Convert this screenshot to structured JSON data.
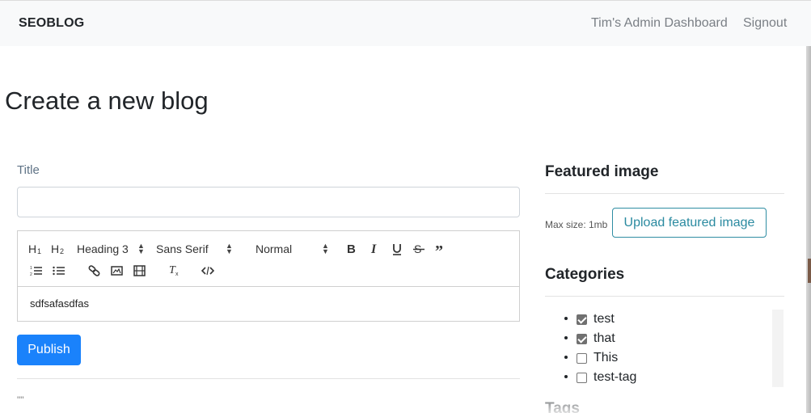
{
  "navbar": {
    "brand": "SEOBLOG",
    "links": [
      "Tim's Admin Dashboard",
      "Signout"
    ]
  },
  "page": {
    "title": "Create a new blog"
  },
  "form": {
    "title_label": "Title",
    "title_value": "",
    "editor": {
      "heading_picker": "Heading 3",
      "font_picker": "Sans Serif",
      "size_picker": "Normal",
      "content": "sdfsafasdfas"
    },
    "publish_label": "Publish",
    "quote_text": "\"\""
  },
  "sidebar": {
    "featured_heading": "Featured image",
    "max_size": "Max size: 1mb",
    "upload_label": "Upload featured image",
    "categories_heading": "Categories",
    "categories": [
      {
        "label": "test",
        "checked": true
      },
      {
        "label": "that",
        "checked": true
      },
      {
        "label": "This",
        "checked": false
      },
      {
        "label": "test-tag",
        "checked": false
      }
    ],
    "tags_heading": "Tags"
  },
  "colors": {
    "primary": "#1a82fb",
    "outline_info": "#2f8da3",
    "navbar_bg": "#f8f9fa"
  },
  "icons": [
    "h1-icon",
    "h2-icon",
    "bold-icon",
    "italic-icon",
    "underline-icon",
    "strike-icon",
    "blockquote-icon",
    "ordered-list-icon",
    "bullet-list-icon",
    "link-icon",
    "image-icon",
    "video-icon",
    "clean-icon",
    "code-icon"
  ]
}
